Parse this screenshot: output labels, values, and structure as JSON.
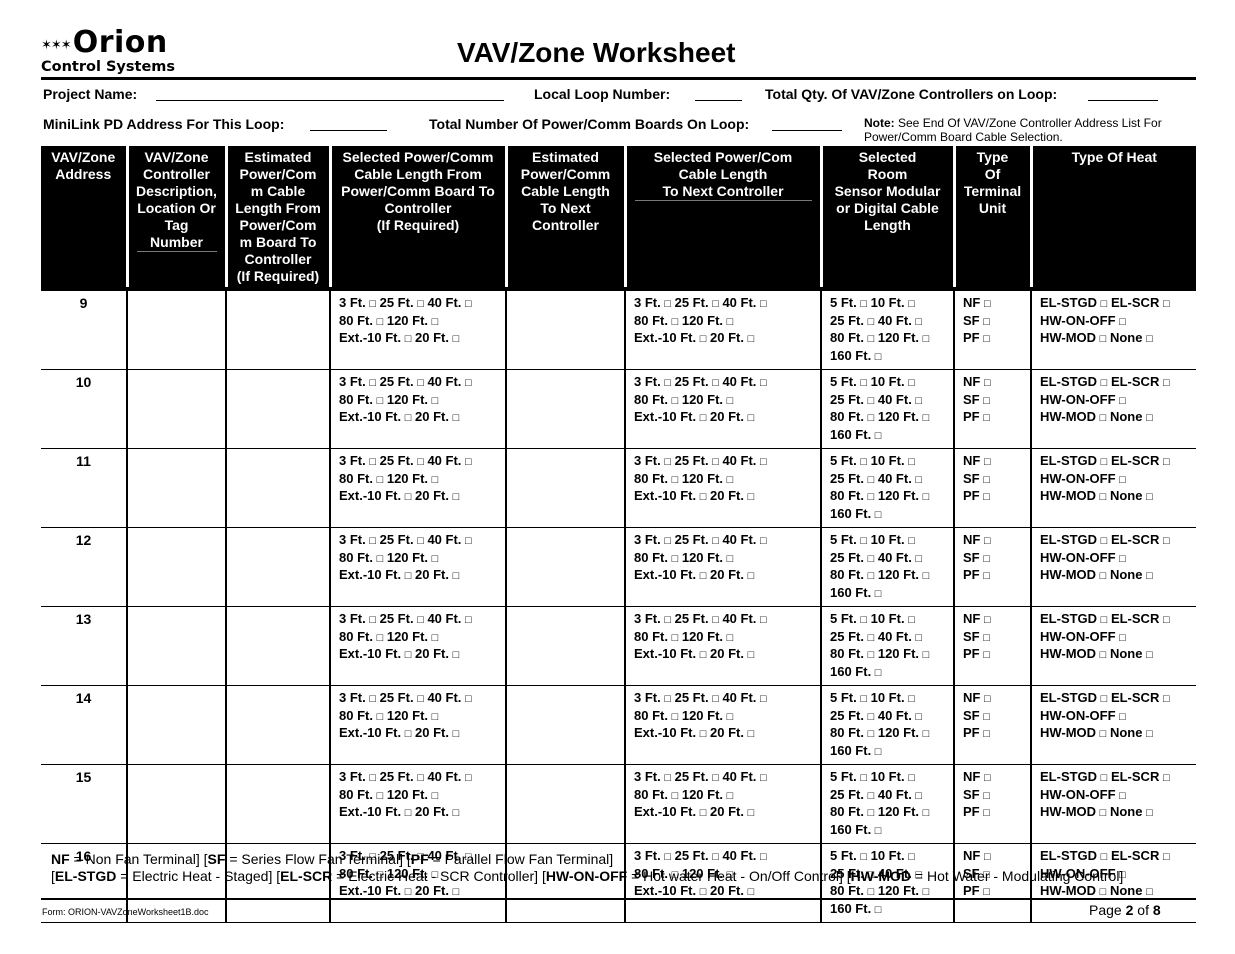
{
  "logo": {
    "stars": "✶✶✶",
    "brand": "Orion",
    "sub": "Control Systems"
  },
  "title": "VAV/Zone Worksheet",
  "meta": {
    "project_name_label": "Project Name:",
    "local_loop_label": "Local Loop Number:",
    "total_qty_label": "Total Qty. Of VAV/Zone Controllers  on Loop:",
    "minilink_label": "MiniLink PD Address For This Loop:",
    "total_boards_label": "Total Number Of Power/Comm Boards On Loop:",
    "note_label": "Note:",
    "note_text": " See End Of VAV/Zone Controller Address List For Power/Comm Board Cable Selection."
  },
  "columns": [
    "VAV/Zone Address",
    "VAV/Zone Controller Description, Location Or Tag Number",
    "Estimated Power/Com m Cable Length From Power/Com m Board To Controller (If Required)",
    "Selected Power/Comm Cable Length From Power/Comm Board To Controller (If Required)",
    "Estimated Power/Comm Cable Length To Next Controller",
    "Selected Power/Com Cable Length To Next Controller",
    "Selected Room Sensor Modular or Digital Cable Length",
    "Type Of Terminal Unit",
    "Type Of Heat"
  ],
  "column_lines": {
    "c0": [
      "VAV/Zone",
      "Address"
    ],
    "c1": [
      "VAV/Zone",
      "Controller",
      "Description,",
      "Location Or",
      "Tag",
      "Number"
    ],
    "c2": [
      "Estimated",
      "Power/Com",
      "m Cable",
      "Length From",
      "Power/Com",
      "m Board To",
      "Controller",
      "(If Required)"
    ],
    "c3": [
      "Selected Power/Comm",
      "Cable Length From",
      "Power/Comm Board To",
      "Controller",
      "(If Required)"
    ],
    "c4": [
      "Estimated",
      "Power/Comm",
      "Cable Length",
      "To Next",
      "Controller"
    ],
    "c5": [
      "Selected Power/Com",
      "Cable Length",
      "To Next Controller"
    ],
    "c6": [
      "Selected",
      "Room",
      "Sensor Modular",
      "or Digital Cable",
      "Length"
    ],
    "c7": [
      "Type",
      "Of",
      "Terminal",
      "Unit"
    ],
    "c8": [
      "Type Of Heat"
    ]
  },
  "options": {
    "cable": [
      "3 Ft. □  25 Ft. □  40 Ft. □",
      "80 Ft. □  120 Ft. □",
      "Ext.-10 Ft. □  20 Ft. □"
    ],
    "sensor": [
      "5 Ft. □  10 Ft. □",
      "25 Ft. □ 40 Ft. □",
      "80 Ft. □ 120 Ft. □",
      "160 Ft. □"
    ],
    "terminal": [
      "NF □",
      "SF □",
      "PF □"
    ],
    "heat": [
      "EL-STGD □ EL-SCR □",
      "HW-ON-OFF □",
      "HW-MOD □ None □"
    ]
  },
  "rows": [
    {
      "address": "9"
    },
    {
      "address": "10"
    },
    {
      "address": "11"
    },
    {
      "address": "12"
    },
    {
      "address": "13"
    },
    {
      "address": "14"
    },
    {
      "address": "15"
    },
    {
      "address": "16"
    }
  ],
  "legend": {
    "line1": [
      {
        "b": "NF"
      },
      {
        "t": " = Non Fan Terminal] ["
      },
      {
        "b": "SF"
      },
      {
        "t": " = Series Flow Fan Terminal] ["
      },
      {
        "b": "PF"
      },
      {
        "t": " = Parallel Flow Fan Terminal]"
      }
    ],
    "line2": [
      {
        "t": "["
      },
      {
        "b": "EL-STGD"
      },
      {
        "t": " = Electric Heat  - Staged] ["
      },
      {
        "b": "EL-SCR"
      },
      {
        "t": " = Electric Heat  - SCR Controller] ["
      },
      {
        "b": "HW-ON-OFF"
      },
      {
        "t": " = Hot water Heat  - On/Off Control] ["
      },
      {
        "b": "HW-MOD"
      },
      {
        "t": " = Hot Water - Modulating Control]"
      }
    ]
  },
  "footer": {
    "form_id": "Form: ORION-VAVZoneWorksheet1B.doc",
    "page_prefix": "Page ",
    "page_current": "2",
    "page_mid": " of ",
    "page_total": "8"
  }
}
